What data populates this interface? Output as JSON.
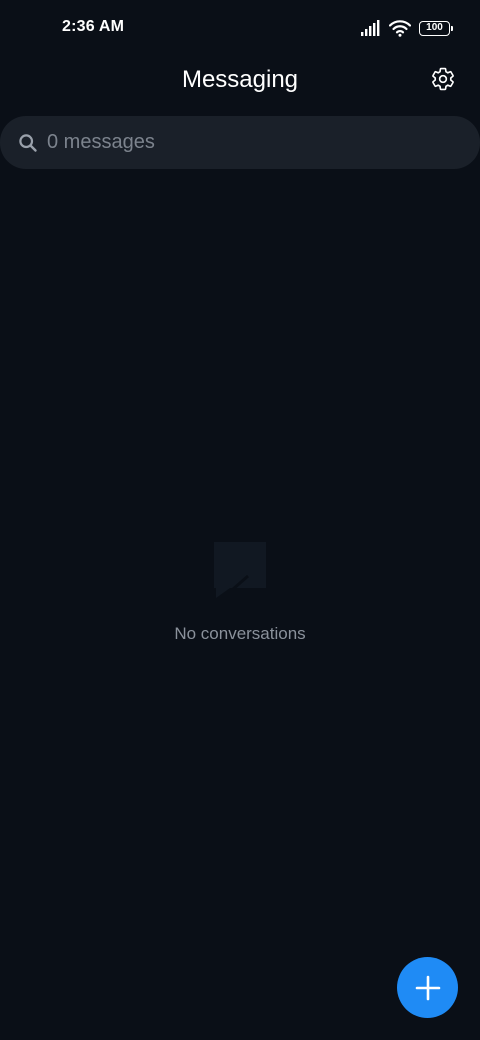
{
  "status_bar": {
    "time": "2:36 AM",
    "battery_level": "100",
    "icons": [
      "signal-icon",
      "wifi-icon",
      "battery-icon"
    ]
  },
  "header": {
    "title": "Messaging",
    "settings_icon": "gear-icon"
  },
  "search": {
    "placeholder": "0 messages",
    "value": "",
    "icon": "search-icon"
  },
  "empty_state": {
    "icon": "empty-chat-icon",
    "message": "No conversations"
  },
  "fab": {
    "icon": "plus-icon",
    "color": "#1f8bf5"
  },
  "colors": {
    "background": "#0a0f17",
    "search_background": "#1a2029",
    "muted_text": "#8a919b",
    "accent": "#1f8bf5"
  }
}
